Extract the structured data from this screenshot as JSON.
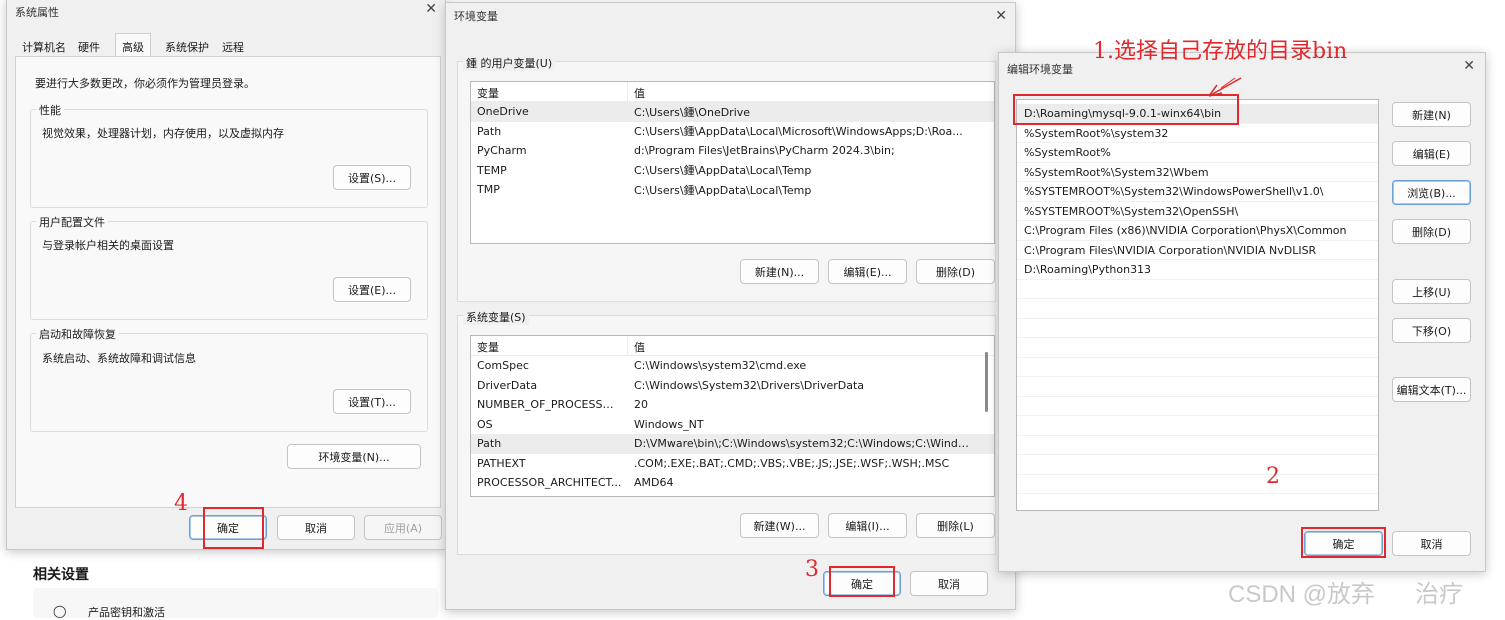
{
  "sys_props": {
    "title": "系统属性",
    "close": "✕",
    "tabs": [
      "计算机名",
      "硬件",
      "高级",
      "系统保护",
      "远程"
    ],
    "admin_note": "要进行大多数更改，你必须作为管理员登录。",
    "perf": {
      "title": "性能",
      "desc": "视觉效果，处理器计划，内存使用，以及虚拟内存",
      "button": "设置(S)..."
    },
    "profile": {
      "title": "用户配置文件",
      "desc": "与登录帐户相关的桌面设置",
      "button": "设置(E)..."
    },
    "startup": {
      "title": "启动和故障恢复",
      "desc": "系统启动、系统故障和调试信息",
      "button": "设置(T)..."
    },
    "env_button": "环境变量(N)...",
    "ok": "确定",
    "cancel": "取消",
    "apply": "应用(A)"
  },
  "background": {
    "related_title": "相关设置",
    "partial_text": "产品密钥和激活"
  },
  "env_vars": {
    "title": "环境变量",
    "close": "✕",
    "user_group": "鍾 的用户变量(U)",
    "col_var": "变量",
    "col_val": "值",
    "user_rows": [
      {
        "name": "OneDrive",
        "value": "C:\\Users\\鍾\\OneDrive"
      },
      {
        "name": "Path",
        "value": "C:\\Users\\鍾\\AppData\\Local\\Microsoft\\WindowsApps;D:\\Roa..."
      },
      {
        "name": "PyCharm",
        "value": "d:\\Program Files\\JetBrains\\PyCharm 2024.3\\bin;"
      },
      {
        "name": "TEMP",
        "value": "C:\\Users\\鍾\\AppData\\Local\\Temp"
      },
      {
        "name": "TMP",
        "value": "C:\\Users\\鍾\\AppData\\Local\\Temp"
      }
    ],
    "user_buttons": {
      "new": "新建(N)...",
      "edit": "编辑(E)...",
      "delete": "删除(D)"
    },
    "sys_group": "系统变量(S)",
    "sys_rows": [
      {
        "name": "ComSpec",
        "value": "C:\\Windows\\system32\\cmd.exe"
      },
      {
        "name": "DriverData",
        "value": "C:\\Windows\\System32\\Drivers\\DriverData"
      },
      {
        "name": "NUMBER_OF_PROCESSORS",
        "value": "20"
      },
      {
        "name": "OS",
        "value": "Windows_NT"
      },
      {
        "name": "Path",
        "value": "D:\\VMware\\bin\\;C:\\Windows\\system32;C:\\Windows;C:\\Windo..."
      },
      {
        "name": "PATHEXT",
        "value": ".COM;.EXE;.BAT;.CMD;.VBS;.VBE;.JS;.JSE;.WSF;.WSH;.MSC"
      },
      {
        "name": "PROCESSOR_ARCHITECT...",
        "value": "AMD64"
      }
    ],
    "sys_buttons": {
      "new": "新建(W)...",
      "edit": "编辑(I)...",
      "delete": "删除(L)"
    },
    "ok": "确定",
    "cancel": "取消"
  },
  "edit_env": {
    "title": "编辑环境变量",
    "close": "✕",
    "entries": [
      "D:\\Roaming\\mysql-9.0.1-winx64\\bin",
      "%SystemRoot%\\system32",
      "%SystemRoot%",
      "%SystemRoot%\\System32\\Wbem",
      "%SYSTEMROOT%\\System32\\WindowsPowerShell\\v1.0\\",
      "%SYSTEMROOT%\\System32\\OpenSSH\\",
      "C:\\Program Files (x86)\\NVIDIA Corporation\\PhysX\\Common",
      "C:\\Program Files\\NVIDIA Corporation\\NVIDIA NvDLISR",
      "D:\\Roaming\\Python313"
    ],
    "buttons": {
      "new": "新建(N)",
      "edit": "编辑(E)",
      "browse": "浏览(B)...",
      "delete": "删除(D)",
      "up": "上移(U)",
      "down": "下移(O)",
      "edit_text": "编辑文本(T)..."
    },
    "ok": "确定",
    "cancel": "取消"
  },
  "annotations": {
    "step1": "1.选择自己存放的目录bin",
    "step2": "2",
    "step3": "3",
    "step4": "4",
    "color": "#e0282d"
  },
  "watermark": "CSDN @放弃      治疗"
}
